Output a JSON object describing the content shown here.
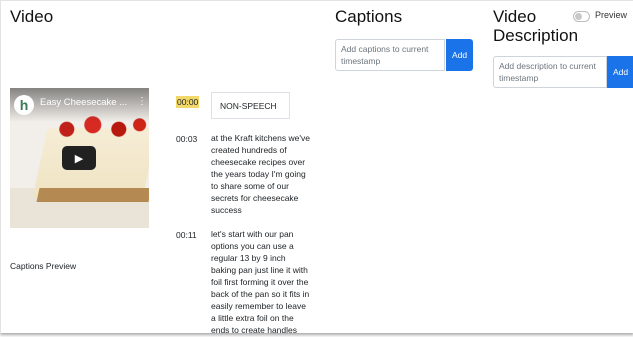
{
  "headings": {
    "video": "Video",
    "captions": "Captions",
    "description": "Video Description",
    "preview_toggle_label": "Preview",
    "captions_preview": "Captions Preview"
  },
  "captions_form": {
    "placeholder": "Add captions to current timestamp",
    "add_label": "Add"
  },
  "description_form": {
    "placeholder": "Add description to current timestamp",
    "add_label": "Add"
  },
  "video": {
    "title": "Easy Cheesecake ...",
    "channel_initial": "h",
    "menu_icon": "more-vert-icon",
    "play_icon": "play-icon"
  },
  "captions": [
    {
      "time": "00:00",
      "text": "NON-SPEECH"
    },
    {
      "time": "00:03",
      "text": "at the Kraft kitchens we've created hundreds of cheesecake recipes over the years today I'm going to share some of our secrets for cheesecake success"
    },
    {
      "time": "00:11",
      "text": "let's start with our pan options you can use a regular 13 by 9 inch baking pan just line it with foil first forming it over the back of the pan so it fits in easily remember to leave a little extra foil on the ends to create handles"
    }
  ],
  "colors": {
    "accent": "#1a73e8",
    "highlight": "#f2d769"
  }
}
